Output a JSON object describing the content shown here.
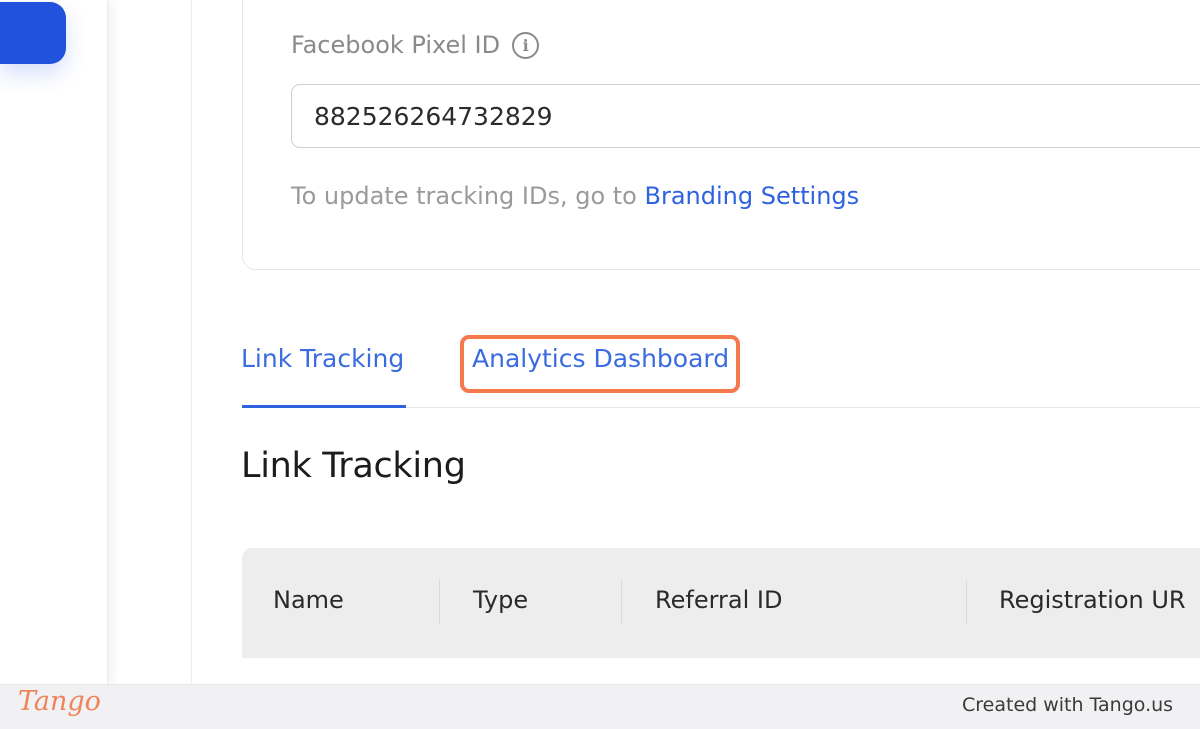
{
  "tracking": {
    "pixel_label": "Facebook Pixel ID",
    "pixel_value": "882526264732829",
    "note_prefix": "To update tracking IDs, go to ",
    "note_link": "Branding Settings"
  },
  "tabs": [
    {
      "label": "Link Tracking"
    },
    {
      "label": "Analytics Dashboard"
    }
  ],
  "section_title": "Link Tracking",
  "table": {
    "columns": [
      "Name",
      "Type",
      "Referral ID",
      "Registration UR"
    ]
  },
  "footer": {
    "logo": "Tango",
    "credit": "Created with Tango.us"
  },
  "colors": {
    "accent": "#2e62de",
    "highlight": "#f47a4c",
    "brand": "#f08458"
  },
  "icons": {
    "info": "info-icon"
  }
}
